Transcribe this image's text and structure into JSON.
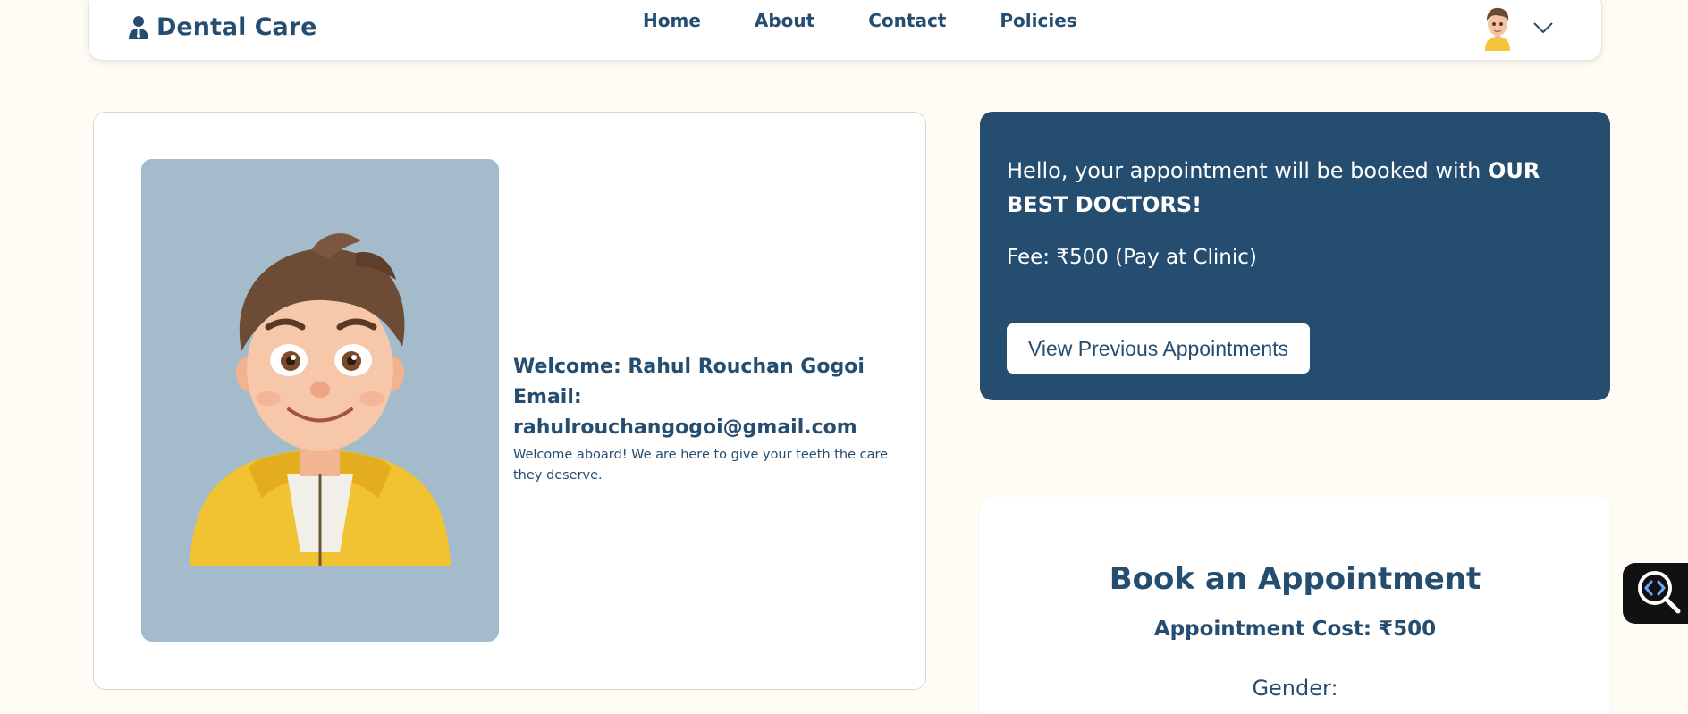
{
  "nav": {
    "brand": "Dental Care",
    "links": [
      "Home",
      "About",
      "Contact",
      "Policies"
    ]
  },
  "profile": {
    "welcome": "Welcome: Rahul Rouchan Gogoi",
    "email": "Email: rahulrouchangogoi@gmail.com",
    "message": "Welcome aboard! We are here to give your teeth the care they deserve."
  },
  "notice": {
    "text": "Hello, your appointment will be booked with",
    "highlight": "OUR BEST DOCTORS!",
    "fee": "Fee: ₹500 (Pay at Clinic)",
    "button": "View Previous Appointments"
  },
  "booking": {
    "title": "Book an Appointment",
    "cost": "Appointment Cost: ₹500",
    "gender_label": "Gender:"
  },
  "colors": {
    "primary": "#254d70",
    "background": "#fffcf5",
    "photo_bg": "#a3bbcb"
  },
  "icons": [
    "user-doctor-icon",
    "avatar",
    "chevron-down-icon",
    "code-search-icon"
  ]
}
